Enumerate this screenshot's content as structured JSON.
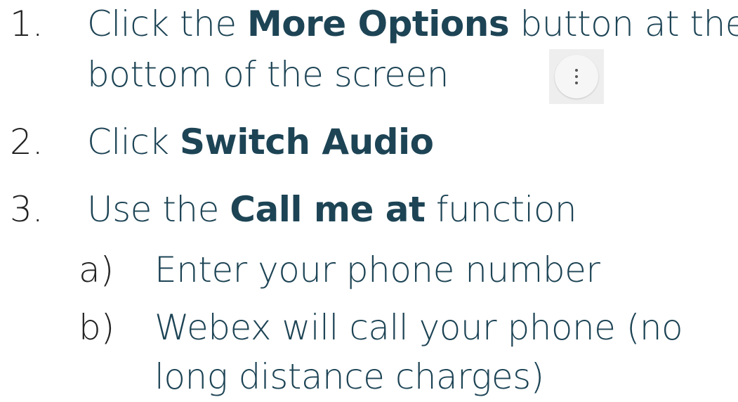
{
  "steps": [
    {
      "number": "1.",
      "line1": {
        "pre": "Click the ",
        "bold": "More Options",
        "post": " button at the"
      },
      "line2": "bottom of the screen"
    },
    {
      "number": "2.",
      "pre": "Click ",
      "bold": "Switch Audio"
    },
    {
      "number": "3.",
      "pre": "Use the ",
      "bold": "Call me at",
      "post": " function"
    }
  ],
  "substeps": [
    {
      "letter": "a)",
      "text": "Enter your phone number"
    },
    {
      "letter": "b)",
      "line1": "Webex will call your phone (no",
      "line2": "long distance charges)"
    }
  ],
  "more_options_button": {
    "icon": "more-vertical-icon"
  },
  "colors": {
    "text": "#1d4455",
    "number": "#222222"
  }
}
